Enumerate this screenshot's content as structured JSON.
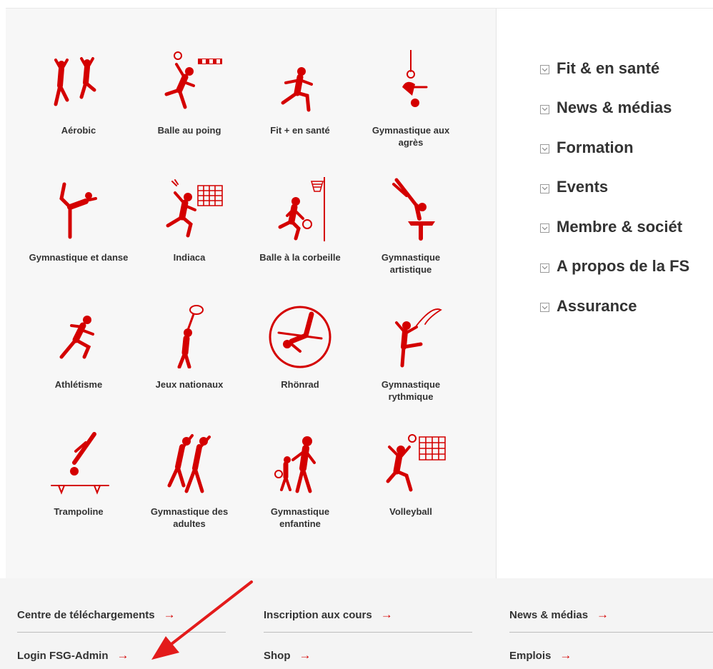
{
  "sports": [
    {
      "label": "Aérobic"
    },
    {
      "label": "Balle au poing"
    },
    {
      "label": "Fit + en santé"
    },
    {
      "label": "Gymnastique aux agrès"
    },
    {
      "label": "Gymnastique et danse"
    },
    {
      "label": "Indiaca"
    },
    {
      "label": "Balle à la corbeille"
    },
    {
      "label": "Gymnastique artistique"
    },
    {
      "label": "Athlétisme"
    },
    {
      "label": "Jeux nationaux"
    },
    {
      "label": "Rhönrad"
    },
    {
      "label": "Gymnastique rythmique"
    },
    {
      "label": "Trampoline"
    },
    {
      "label": "Gymnastique des adultes"
    },
    {
      "label": "Gymnastique enfantine"
    },
    {
      "label": "Volleyball"
    }
  ],
  "menu": [
    {
      "label": "Fit & en santé"
    },
    {
      "label": "News & médias"
    },
    {
      "label": "Formation"
    },
    {
      "label": "Events"
    },
    {
      "label": "Membre & sociét"
    },
    {
      "label": "A propos de la FS"
    },
    {
      "label": "Assurance"
    }
  ],
  "footer": {
    "downloads": "Centre de téléchargements",
    "login": "Login FSG-Admin",
    "courses": "Inscription aux cours",
    "shop": "Shop",
    "news": "News & médias",
    "jobs": "Emplois",
    "arrow": "→"
  },
  "colors": {
    "accent": "#d40000",
    "annotation": "#e31b1b"
  }
}
